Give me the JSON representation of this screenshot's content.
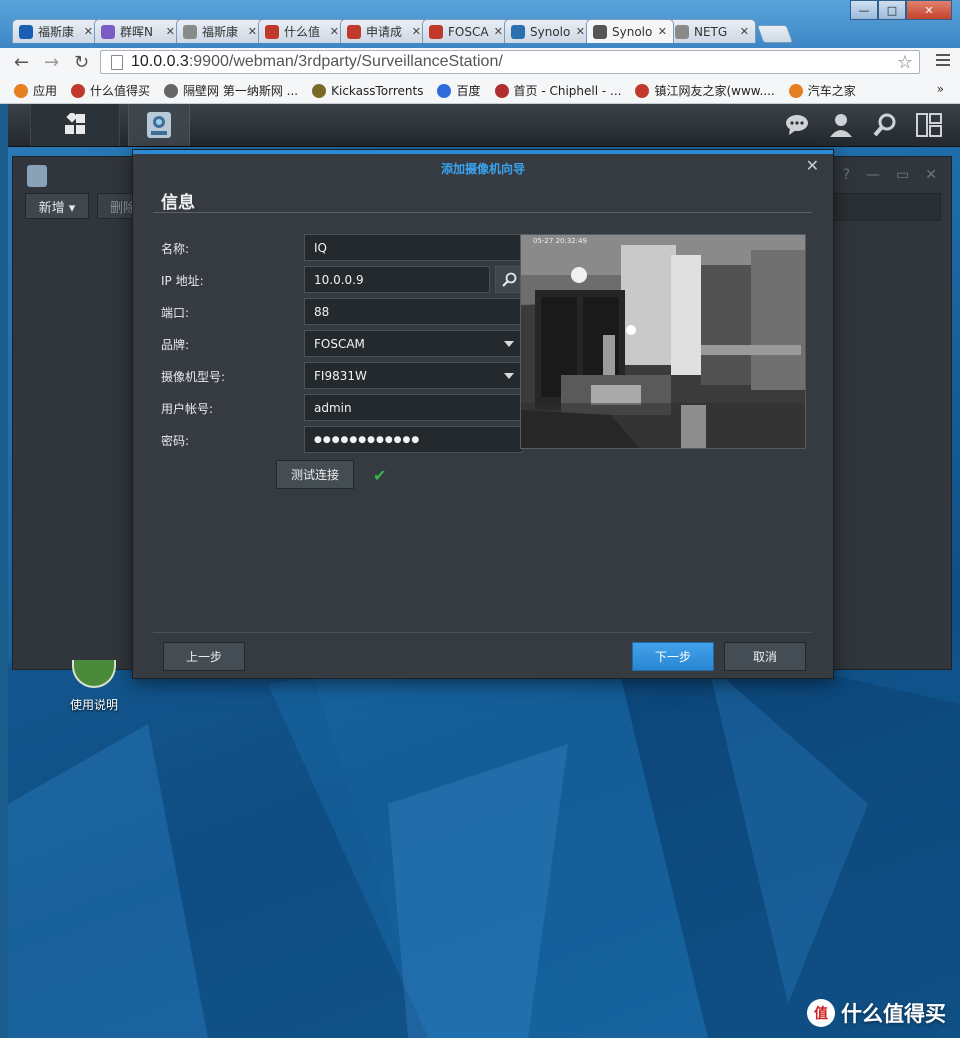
{
  "browser": {
    "tabs": [
      {
        "label": "福斯康",
        "icon": "paw-icon",
        "color": "#1a5fb4",
        "active": false
      },
      {
        "label": "群晖N",
        "icon": "synology-n-icon",
        "color": "#7b5cc4",
        "active": false
      },
      {
        "label": "福斯康",
        "icon": "page-icon",
        "color": "#8a8a8a",
        "active": false
      },
      {
        "label": "什么值",
        "icon": "smzdm-icon",
        "color": "#c0392b",
        "active": false
      },
      {
        "label": "申请成",
        "icon": "smzdm-icon",
        "color": "#c0392b",
        "active": false
      },
      {
        "label": "FOSCA",
        "icon": "smzdm-icon",
        "color": "#c0392b",
        "active": false
      },
      {
        "label": "Synolo",
        "icon": "dsm-icon",
        "color": "#2a6fb0",
        "active": false
      },
      {
        "label": "Synolo",
        "icon": "surveillance-icon",
        "color": "#555555",
        "active": true
      },
      {
        "label": "NETG",
        "icon": "page-icon",
        "color": "#8a8a8a",
        "active": false
      }
    ],
    "url_host": "10.0.0.3",
    "url_rest": ":9900/webman/3rdparty/SurveillanceStation/",
    "bookmarks": [
      {
        "label": "应用",
        "icon": "apps-grid-icon",
        "color": "#e67e22"
      },
      {
        "label": "什么值得买",
        "icon": "smzdm-icon",
        "color": "#c0392b"
      },
      {
        "label": "隔壁网 第一纳斯网 ...",
        "icon": "home-icon",
        "color": "#666666"
      },
      {
        "label": "KickassTorrents",
        "icon": "kickass-icon",
        "color": "#7a6a2a"
      },
      {
        "label": "百度",
        "icon": "baidu-paw-icon",
        "color": "#2f6bd8"
      },
      {
        "label": "首页 - Chiphell - ...",
        "icon": "chiphell-icon",
        "color": "#b03030"
      },
      {
        "label": "镇江网友之家(www....",
        "icon": "zj-icon",
        "color": "#c0392b"
      },
      {
        "label": "汽车之家",
        "icon": "autohome-icon",
        "color": "#e67e22"
      }
    ],
    "more": "»"
  },
  "desktop": {
    "bg_window": {
      "add_label": "新增 ▾",
      "delete_label": "删除"
    },
    "help_shortcut_label": "使用说明",
    "watermark": "什么值得买"
  },
  "wizard": {
    "title": "添加摄像机向导",
    "section": "信息",
    "fields": {
      "name": {
        "label": "名称:",
        "value": "IQ"
      },
      "ip": {
        "label": "IP 地址:",
        "value": "10.0.0.9"
      },
      "port": {
        "label": "端口:",
        "value": "88"
      },
      "brand": {
        "label": "品牌:",
        "value": "FOSCAM"
      },
      "model": {
        "label": "摄像机型号:",
        "value": "FI9831W"
      },
      "user": {
        "label": "用户帐号:",
        "value": "admin"
      },
      "password": {
        "label": "密码:",
        "value": "●●●●●●●●●●●●"
      }
    },
    "test_button": "测试连接",
    "test_status": "✔",
    "preview_timestamp": "05-27 20:32:49",
    "buttons": {
      "prev": "上一步",
      "next": "下一步",
      "cancel": "取消"
    }
  }
}
